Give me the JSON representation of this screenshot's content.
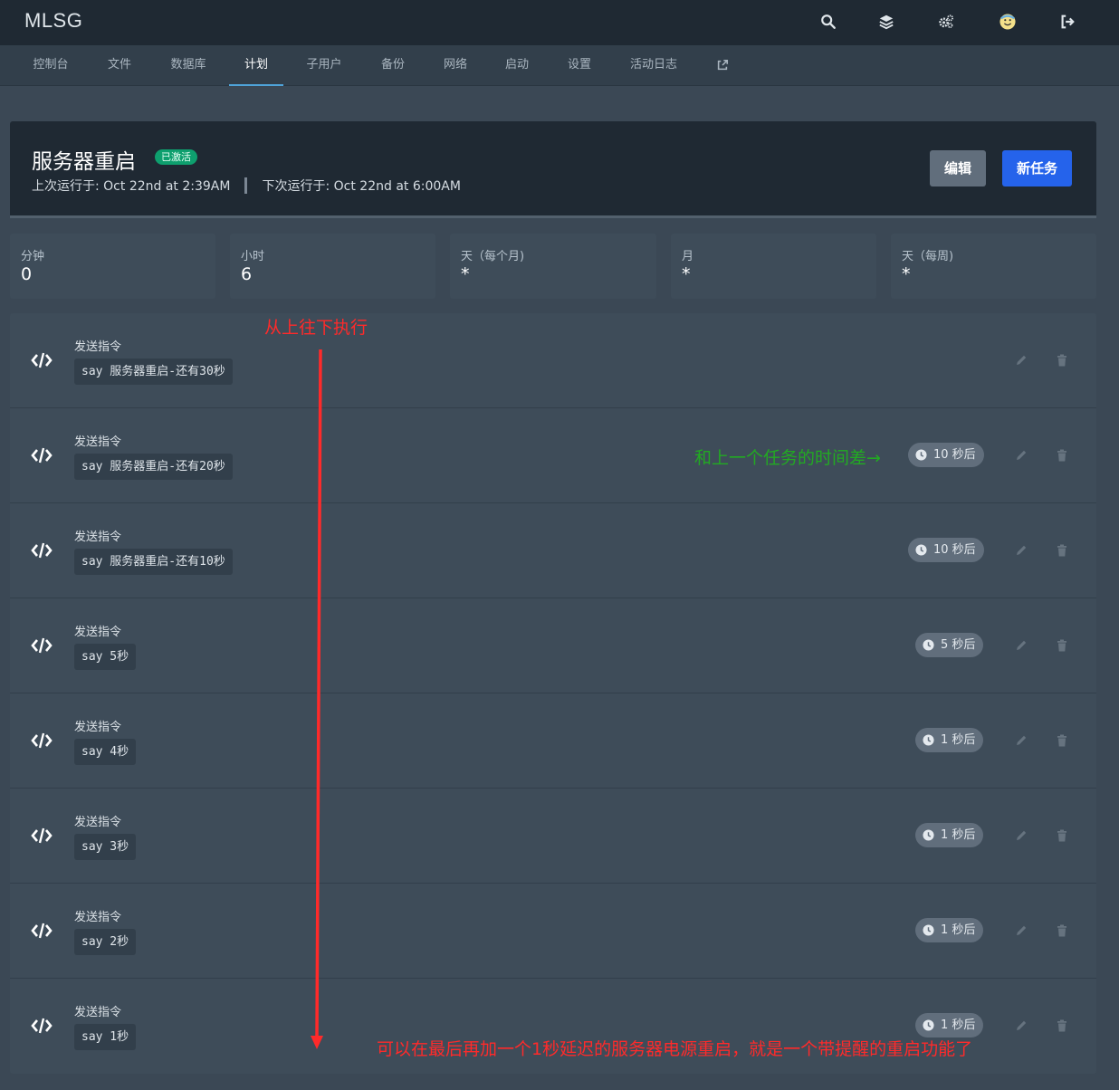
{
  "app": {
    "brand": "MLSG"
  },
  "top_icons": [
    "search-icon",
    "layers-icon",
    "cogs-icon",
    "avatar",
    "logout-icon"
  ],
  "nav": {
    "tabs": [
      {
        "label": "控制台"
      },
      {
        "label": "文件"
      },
      {
        "label": "数据库"
      },
      {
        "label": "计划",
        "active": true
      },
      {
        "label": "子用户"
      },
      {
        "label": "备份"
      },
      {
        "label": "网络"
      },
      {
        "label": "启动"
      },
      {
        "label": "设置"
      },
      {
        "label": "活动日志"
      }
    ],
    "external_icon": "external-link-icon"
  },
  "schedule": {
    "name": "服务器重启",
    "status": "已激活",
    "last_run": "上次运行于: Oct 22nd at 2:39AM",
    "next_run": "下次运行于: Oct 22nd at 6:00AM",
    "edit_label": "编辑",
    "new_task_label": "新任务"
  },
  "cron": [
    {
      "label": "分钟",
      "value": "0"
    },
    {
      "label": "小时",
      "value": "6"
    },
    {
      "label": "天（每个月)",
      "value": "*"
    },
    {
      "label": "月",
      "value": "*"
    },
    {
      "label": "天（每周)",
      "value": "*"
    }
  ],
  "tasks": [
    {
      "title": "发送指令",
      "command": "say 服务器重启-还有30秒",
      "delay": ""
    },
    {
      "title": "发送指令",
      "command": "say 服务器重启-还有20秒",
      "delay": "10 秒后"
    },
    {
      "title": "发送指令",
      "command": "say 服务器重启-还有10秒",
      "delay": "10 秒后"
    },
    {
      "title": "发送指令",
      "command": "say 5秒",
      "delay": "5 秒后"
    },
    {
      "title": "发送指令",
      "command": "say 4秒",
      "delay": "1 秒后"
    },
    {
      "title": "发送指令",
      "command": "say 3秒",
      "delay": "1 秒后"
    },
    {
      "title": "发送指令",
      "command": "say 2秒",
      "delay": "1 秒后"
    },
    {
      "title": "发送指令",
      "command": "say 1秒",
      "delay": "1 秒后"
    }
  ],
  "annotations": {
    "top_to_bottom": "从上往下执行",
    "time_diff": "和上一个任务的时间差→",
    "footer_note": "可以在最后再加一个1秒延迟的服务器电源重启，就是一个带提醒的重启功能了"
  },
  "colors": {
    "topbar": "#1f2933",
    "page_bg": "#3b4855",
    "accent_tab": "#4fa3d9",
    "badge_green": "#0e9f6e",
    "primary_button": "#2563eb",
    "annotation_red": "#ff2a2a",
    "annotation_green": "#22aa22"
  }
}
